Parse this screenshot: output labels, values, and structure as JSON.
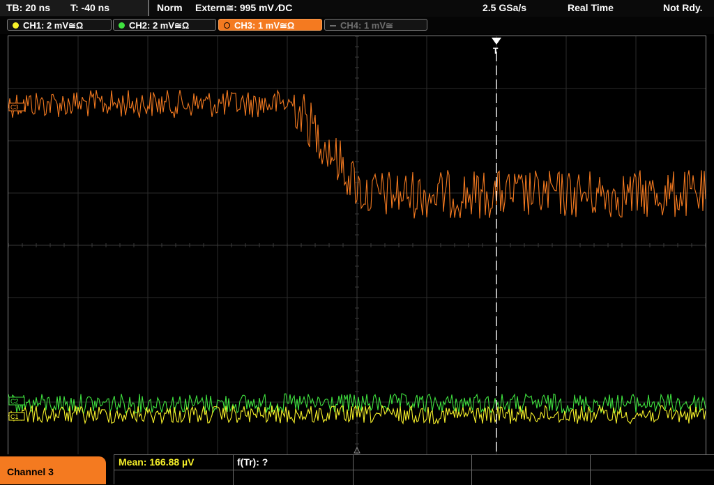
{
  "timebase": {
    "tb": "TB: 20 ns",
    "t": "T: -40 ns"
  },
  "status": {
    "mode": "Norm",
    "trigger": "Extern≅: 995 mV ∕DC",
    "rate": "2.5 GSa/s",
    "acq": "Real Time",
    "state": "Not Rdy."
  },
  "channels": [
    {
      "label": "CH1: 2 mV≅Ω",
      "color": "#f8f22a",
      "state": "on"
    },
    {
      "label": "CH2: 2 mV≅Ω",
      "color": "#3fe23f",
      "state": "on"
    },
    {
      "label": "CH3: 1 mV≅Ω",
      "color": "#f47a20",
      "state": "active"
    },
    {
      "label": "CH4: 1 mV≅",
      "color": "#6f6f6f",
      "state": "off"
    }
  ],
  "markers": {
    "c3": "C3",
    "c2": "C2",
    "c1": "C1",
    "trigger": "T"
  },
  "bottom": {
    "selected_channel": "Channel 3",
    "mean": "Mean: 166.88 µV",
    "ftr": "f(Tr): ?"
  },
  "traces": {
    "ch3_color": "#f47a20",
    "ch2_color": "#3fe23f",
    "ch1_color": "#f8f22a"
  }
}
